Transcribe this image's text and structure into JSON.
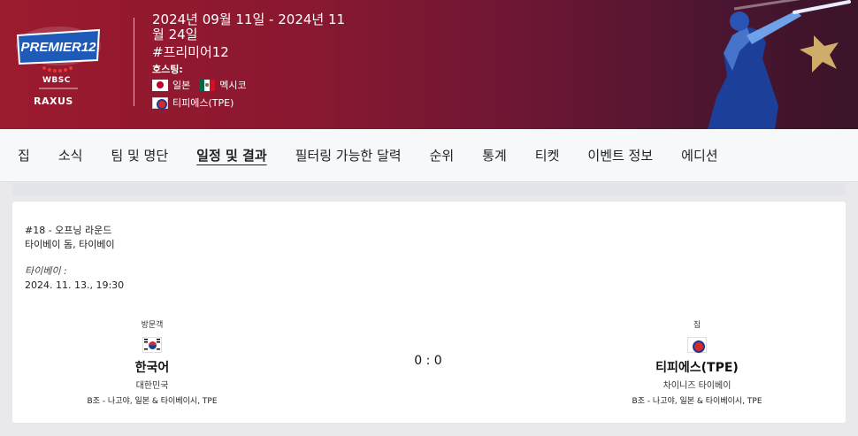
{
  "header": {
    "logo_text": "PREMIER 12",
    "wbsc": "WBSC",
    "raxus": "RAXUS",
    "dates": "2024년 09월 11일 - 2024년 11월 24일",
    "tag": "#프리미어12",
    "host_label": "호스팅:",
    "hosts": [
      {
        "name": "일본",
        "flag": "flag-jp"
      },
      {
        "name": "멕시코",
        "flag": "flag-mx"
      },
      {
        "name": "티피에스(TPE)",
        "flag": "flag-tpe"
      }
    ]
  },
  "nav": {
    "items": [
      {
        "label": "집"
      },
      {
        "label": "소식"
      },
      {
        "label": "팀 및 명단"
      },
      {
        "label": "일정 및 결과",
        "active": true
      },
      {
        "label": "필터링 가능한 달력"
      },
      {
        "label": "순위"
      },
      {
        "label": "통계"
      },
      {
        "label": "티켓"
      },
      {
        "label": "이벤트 정보"
      },
      {
        "label": "에디션"
      }
    ]
  },
  "match": {
    "game_no": "#18 - 오프닝 라운드",
    "venue": "타이베이 돔, 타이베이",
    "local_label": "타이베이 :",
    "datetime": "2024. 11. 13., 19:30",
    "score": "0 : 0",
    "away": {
      "role": "방문객",
      "name": "한국어",
      "sub": "대한민국",
      "group": "B조 - 나고야, 일본 & 타이베이시, TPE",
      "flag": "flag-kr"
    },
    "home": {
      "role": "집",
      "name": "티피에스(TPE)",
      "sub": "차이니즈 타이베이",
      "group": "B조 - 나고야, 일본 & 타이베이시, TPE",
      "flag": "flag-tpe2"
    }
  }
}
